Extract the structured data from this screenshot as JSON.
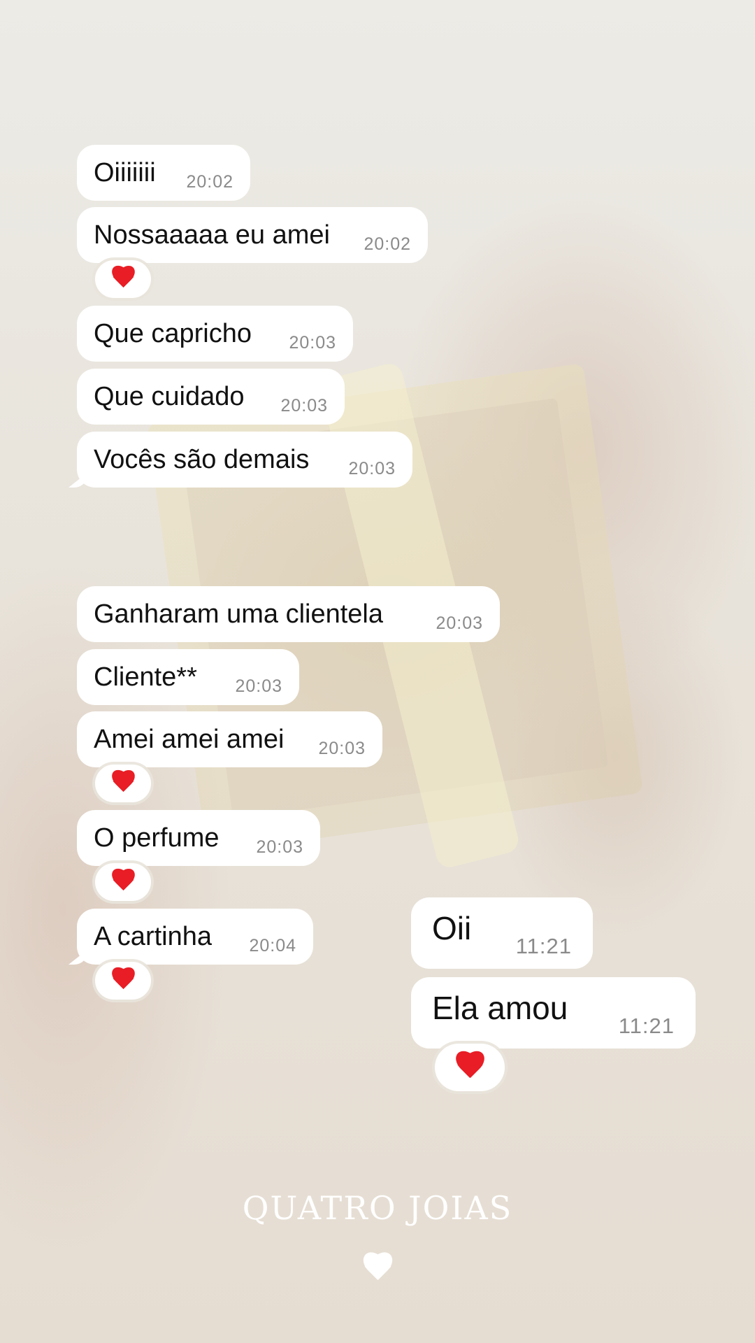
{
  "messages_received": [
    {
      "text": "Oiiiiiii",
      "time": "20:02",
      "reaction": false
    },
    {
      "text": "Nossaaaaa eu amei",
      "time": "20:02",
      "reaction": true
    },
    {
      "text": "Que capricho",
      "time": "20:03",
      "reaction": false
    },
    {
      "text": "Que cuidado",
      "time": "20:03",
      "reaction": false
    },
    {
      "text": "Vocês são demais",
      "time": "20:03",
      "reaction": false
    },
    {
      "text": "Ganharam uma clientela",
      "time": "20:03",
      "reaction": false
    },
    {
      "text": "Cliente**",
      "time": "20:03",
      "reaction": false
    },
    {
      "text": "Amei amei amei",
      "time": "20:03",
      "reaction": true
    },
    {
      "text": "O perfume",
      "time": "20:03",
      "reaction": true
    },
    {
      "text": "A cartinha",
      "time": "20:04",
      "reaction": true
    }
  ],
  "messages_reply": [
    {
      "text": "Oii",
      "time": "11:21",
      "reaction": false
    },
    {
      "text": "Ela amou",
      "time": "11:21",
      "reaction": true
    }
  ],
  "brand": {
    "name": "QUATRO JOIAS",
    "icon": "heart-icon"
  },
  "colors": {
    "reaction_heart": "#e81d25",
    "bubble": "#ffffff",
    "timestamp": "#8a8a8a"
  }
}
